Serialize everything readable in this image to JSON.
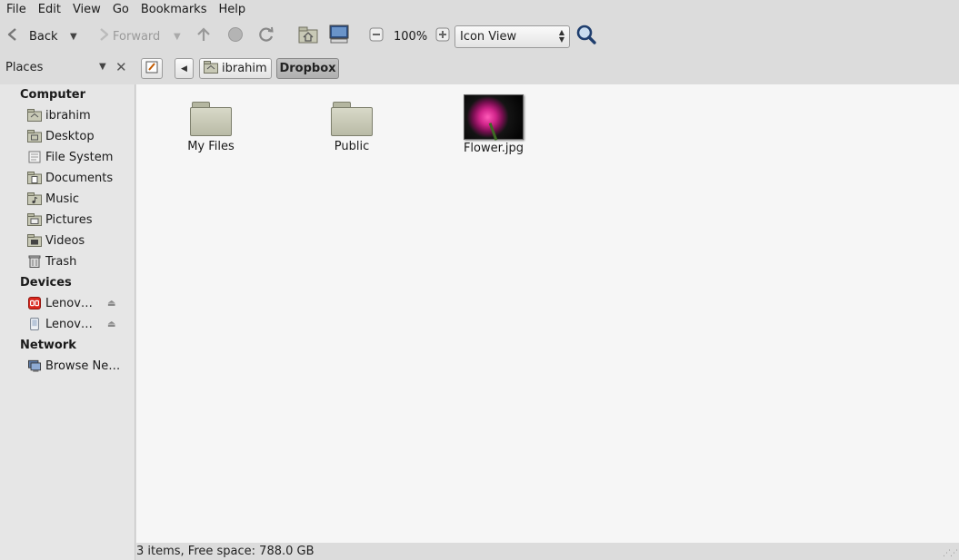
{
  "menubar": {
    "items": [
      "File",
      "Edit",
      "View",
      "Go",
      "Bookmarks",
      "Help"
    ]
  },
  "toolbar": {
    "back_label": "Back",
    "forward_label": "Forward",
    "zoom_level": "100%",
    "view_mode": "Icon View",
    "icons": [
      "back-arrow-icon",
      "up-arrow-icon",
      "stop-icon",
      "reload-icon",
      "home-icon",
      "computer-icon",
      "zoom-out-icon",
      "zoom-in-icon",
      "search-icon"
    ]
  },
  "location": {
    "places_label": "Places",
    "breadcrumbs": [
      "ibrahim",
      "Dropbox"
    ]
  },
  "sidebar": {
    "sections": [
      {
        "title": "Computer",
        "items": [
          {
            "label": "ibrahim",
            "icon": "home-folder-icon"
          },
          {
            "label": "Desktop",
            "icon": "desktop-folder-icon"
          },
          {
            "label": "File System",
            "icon": "filesystem-icon"
          },
          {
            "label": "Documents",
            "icon": "documents-folder-icon"
          },
          {
            "label": "Music",
            "icon": "music-folder-icon"
          },
          {
            "label": "Pictures",
            "icon": "pictures-folder-icon"
          },
          {
            "label": "Videos",
            "icon": "videos-folder-icon"
          },
          {
            "label": "Trash",
            "icon": "trash-icon"
          }
        ]
      },
      {
        "title": "Devices",
        "items": [
          {
            "label": "Lenov…",
            "icon": "device-icon"
          },
          {
            "label": "Lenov…",
            "icon": "drive-icon"
          }
        ]
      },
      {
        "title": "Network",
        "items": [
          {
            "label": "Browse Ne…",
            "icon": "network-icon"
          }
        ]
      }
    ]
  },
  "files": [
    {
      "name": "My Files",
      "type": "folder"
    },
    {
      "name": "Public",
      "type": "folder"
    },
    {
      "name": "Flower.jpg",
      "type": "image"
    }
  ],
  "statusbar": {
    "text": "3 items, Free space: 788.0 GB"
  },
  "colors": {
    "accent_device": "#d8261d",
    "window_bg": "#dcdcdc",
    "content_bg": "#f6f6f6"
  }
}
